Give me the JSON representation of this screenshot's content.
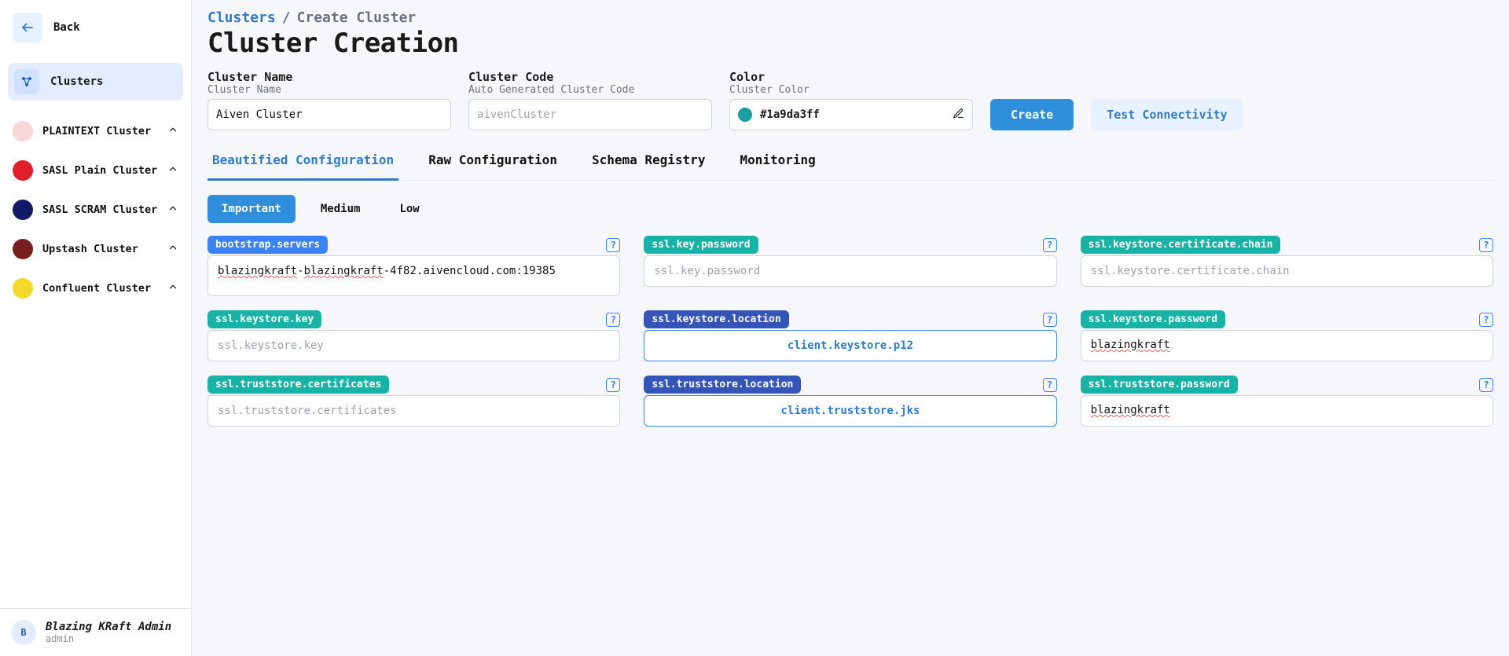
{
  "sidebar": {
    "back_label": "Back",
    "active_label": "Clusters",
    "clusters": [
      {
        "label": "PLAINTEXT Cluster",
        "color": "#f6d6d6"
      },
      {
        "label": "SASL Plain Cluster",
        "color": "#e11d27"
      },
      {
        "label": "SASL SCRAM Cluster",
        "color": "#101a66"
      },
      {
        "label": "Upstash Cluster",
        "color": "#7a1f1f"
      },
      {
        "label": "Confluent Cluster",
        "color": "#f4d92a"
      }
    ],
    "user": {
      "initial": "B",
      "name": "Blazing KRaft Admin",
      "role": "admin"
    }
  },
  "breadcrumb": {
    "root": "Clusters",
    "sep": "/",
    "current": "Create Cluster"
  },
  "page_title": "Cluster Creation",
  "top_form": {
    "name": {
      "label": "Cluster Name",
      "hint": "Cluster Name",
      "value": "Aiven Cluster"
    },
    "code": {
      "label": "Cluster Code",
      "hint": "Auto Generated Cluster Code",
      "value": "aivenCluster"
    },
    "color": {
      "label": "Color",
      "hint": "Cluster Color",
      "hex": "#1a9da3ff",
      "swatch": "#1a9da3"
    },
    "create_label": "Create",
    "test_label": "Test Connectivity"
  },
  "tabs": [
    "Beautified Configuration",
    "Raw Configuration",
    "Schema Registry",
    "Monitoring"
  ],
  "active_tab": 0,
  "priority_pills": [
    "Important",
    "Medium",
    "Low"
  ],
  "active_pill": 0,
  "badge_colors": {
    "blue": "#3b82f6",
    "teal": "#17b3a6",
    "navy": "#3554b8"
  },
  "config": {
    "bootstrap_servers": {
      "label": "bootstrap.servers",
      "badge": "blue",
      "value_html": "<span class='spellred'>blazingkraft</span>-<span class='spellred'>blazingkraft</span>-4f82.aivencloud.com:19385"
    },
    "ssl_key_password": {
      "label": "ssl.key.password",
      "badge": "teal",
      "placeholder": "ssl.key.password"
    },
    "ssl_keystore_certificate_chain": {
      "label": "ssl.keystore.certificate.chain",
      "badge": "teal",
      "placeholder": "ssl.keystore.certificate.chain"
    },
    "ssl_keystore_key": {
      "label": "ssl.keystore.key",
      "badge": "teal",
      "placeholder": "ssl.keystore.key"
    },
    "ssl_keystore_location": {
      "label": "ssl.keystore.location",
      "badge": "navy",
      "value": "client.keystore.p12",
      "link": true
    },
    "ssl_keystore_password": {
      "label": "ssl.keystore.password",
      "badge": "teal",
      "value_html": "<span class='spellred'>blazingkraft</span>"
    },
    "ssl_truststore_certificates": {
      "label": "ssl.truststore.certificates",
      "badge": "teal",
      "placeholder": "ssl.truststore.certificates"
    },
    "ssl_truststore_location": {
      "label": "ssl.truststore.location",
      "badge": "navy",
      "value": "client.truststore.jks",
      "link": true
    },
    "ssl_truststore_password": {
      "label": "ssl.truststore.password",
      "badge": "teal",
      "value_html": "<span class='spellred'>blazingkraft</span>"
    }
  }
}
